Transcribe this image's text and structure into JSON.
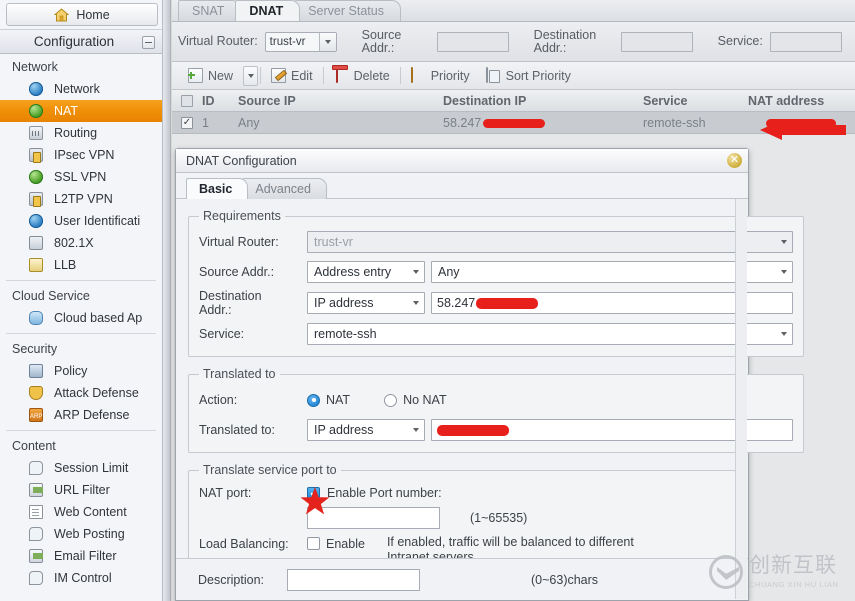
{
  "sidebar": {
    "home_label": "Home",
    "section_title": "Configuration",
    "groups": [
      {
        "title": "Network",
        "items": [
          {
            "label": "Network",
            "icon": "globe-icon",
            "active": false
          },
          {
            "label": "NAT",
            "icon": "nat-globe-icon",
            "active": true
          },
          {
            "label": "Routing",
            "icon": "routing-icon",
            "active": false
          },
          {
            "label": "IPsec VPN",
            "icon": "ipsec-lock-icon",
            "active": false
          },
          {
            "label": "SSL VPN",
            "icon": "ssl-globe-icon",
            "active": false
          },
          {
            "label": "L2TP VPN",
            "icon": "l2tp-icon",
            "active": false
          },
          {
            "label": "User Identificati",
            "icon": "user-id-icon",
            "active": false
          },
          {
            "label": "802.1X",
            "icon": "dot1x-icon",
            "active": false
          },
          {
            "label": "LLB",
            "icon": "llb-icon",
            "active": false
          }
        ]
      },
      {
        "title": "Cloud Service",
        "items": [
          {
            "label": "Cloud based Ap",
            "icon": "cloud-icon",
            "active": false
          }
        ]
      },
      {
        "title": "Security",
        "items": [
          {
            "label": "Policy",
            "icon": "policy-icon",
            "active": false
          },
          {
            "label": "Attack Defense",
            "icon": "shield-icon",
            "active": false
          },
          {
            "label": "ARP Defense",
            "icon": "arp-defense-icon",
            "active": false
          }
        ]
      },
      {
        "title": "Content",
        "items": [
          {
            "label": "Session Limit",
            "icon": "session-limit-icon",
            "active": false
          },
          {
            "label": "URL Filter",
            "icon": "url-filter-icon",
            "active": false
          },
          {
            "label": "Web Content",
            "icon": "web-content-icon",
            "active": false
          },
          {
            "label": "Web Posting",
            "icon": "web-posting-icon",
            "active": false
          },
          {
            "label": "Email Filter",
            "icon": "email-filter-icon",
            "active": false
          },
          {
            "label": "IM Control",
            "icon": "im-control-icon",
            "active": false
          }
        ]
      }
    ]
  },
  "tabs": [
    {
      "label": "SNAT",
      "active": false
    },
    {
      "label": "DNAT",
      "active": true
    },
    {
      "label": "Server Status",
      "active": false
    }
  ],
  "filter_bar": {
    "virtual_router_label": "Virtual Router:",
    "virtual_router_value": "trust-vr",
    "source_addr_label": "Source\nAddr.:",
    "source_addr_value": "",
    "destination_addr_label": "Destination\nAddr.:",
    "destination_addr_value": "",
    "service_label": "Service:",
    "service_value": ""
  },
  "toolbar": {
    "new_label": "New",
    "edit_label": "Edit",
    "delete_label": "Delete",
    "priority_label": "Priority",
    "sort_priority_label": "Sort Priority"
  },
  "table": {
    "columns": [
      "ID",
      "Source IP",
      "Destination IP",
      "Service",
      "NAT address"
    ],
    "rows": [
      {
        "checked": true,
        "id": "1",
        "source_ip": "Any",
        "destination_ip": "58.247",
        "destination_ip_redacted": true,
        "service": "remote-ssh",
        "nat_address": "",
        "nat_address_redacted": true
      }
    ]
  },
  "dialog": {
    "title": "DNAT Configuration",
    "close_label": "✕",
    "tabs": [
      {
        "label": "Basic",
        "active": true
      },
      {
        "label": "Advanced",
        "active": false
      }
    ],
    "requirements": {
      "legend": "Requirements",
      "virtual_router_label": "Virtual Router:",
      "virtual_router_value": "trust-vr",
      "source_addr_label": "Source Addr.:",
      "source_addr_type": "Address entry",
      "source_addr_value": "Any",
      "destination_addr_label": "Destination\nAddr.:",
      "destination_addr_type": "IP address",
      "destination_addr_value": "58.247",
      "destination_addr_redacted": true,
      "service_label": "Service:",
      "service_value": "remote-ssh"
    },
    "translated_to": {
      "legend": "Translated to",
      "action_label": "Action:",
      "action_options": [
        "NAT",
        "No NAT"
      ],
      "action_selected": "NAT",
      "translated_to_label": "Translated to:",
      "translated_to_type": "IP address",
      "translated_to_value": "",
      "translated_to_redacted": true
    },
    "translate_port": {
      "legend": "Translate service port to",
      "nat_port_label": "NAT port:",
      "enable_port_label": "Enable Port number:",
      "enable_port_checked": true,
      "port_value": "",
      "port_range_hint": "(1~65535)",
      "load_balancing_label": "Load Balancing:",
      "load_balancing_enable_label": "Enable",
      "load_balancing_checked": false,
      "load_balancing_note": "If enabled, traffic will be balanced to different Intranet servers."
    },
    "description": {
      "label": "Description:",
      "value": "",
      "hint": "(0~63)chars"
    }
  },
  "watermark": {
    "chinese": "创新互联",
    "pinyin": "CHUANG XIN HU LIAN"
  },
  "colors": {
    "accent_orange": "#ef8f07",
    "redaction_red": "#e8201b",
    "star_red": "#e3231c",
    "checkbox_blue": "#2489d8"
  }
}
